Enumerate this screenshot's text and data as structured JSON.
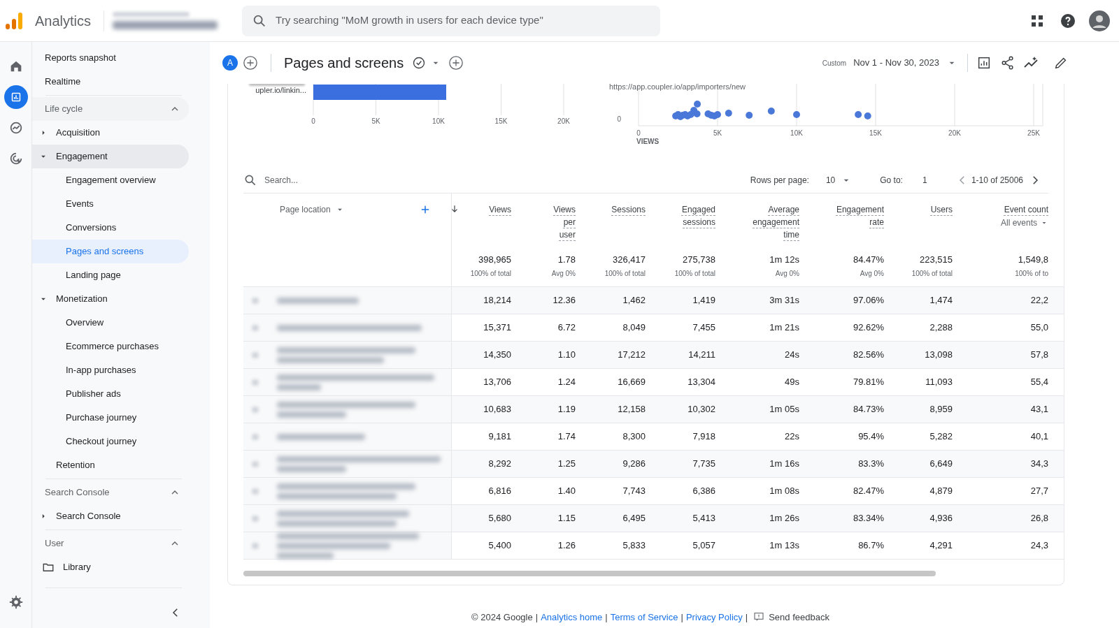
{
  "app": {
    "name": "Analytics"
  },
  "search": {
    "placeholder": "Try searching \"MoM growth in users for each device type\""
  },
  "rail": [
    {
      "kind": "home",
      "selected": false
    },
    {
      "kind": "reports",
      "selected": true
    },
    {
      "kind": "explore",
      "selected": false
    },
    {
      "kind": "advertising",
      "selected": false
    }
  ],
  "sidebar": {
    "top": [
      {
        "label": "Reports snapshot"
      },
      {
        "label": "Realtime"
      }
    ],
    "sections": [
      {
        "title": "Life cycle",
        "expanded": true,
        "items": [
          {
            "kind": "group",
            "label": "Acquisition",
            "expanded": false
          },
          {
            "kind": "group",
            "label": "Engagement",
            "expanded": true,
            "children": [
              {
                "label": "Engagement overview",
                "selected": false
              },
              {
                "label": "Events",
                "selected": false
              },
              {
                "label": "Conversions",
                "selected": false
              },
              {
                "label": "Pages and screens",
                "selected": true
              },
              {
                "label": "Landing page",
                "selected": false
              }
            ]
          },
          {
            "kind": "group",
            "label": "Monetization",
            "expanded": true,
            "children": [
              {
                "label": "Overview",
                "selected": false
              },
              {
                "label": "Ecommerce purchases",
                "selected": false
              },
              {
                "label": "In-app purchases",
                "selected": false
              },
              {
                "label": "Publisher ads",
                "selected": false
              },
              {
                "label": "Purchase journey",
                "selected": false
              },
              {
                "label": "Checkout journey",
                "selected": false
              }
            ]
          },
          {
            "kind": "link",
            "label": "Retention"
          }
        ]
      },
      {
        "title": "Search Console",
        "expanded": true,
        "items": [
          {
            "kind": "group",
            "label": "Search Console",
            "expanded": false
          }
        ]
      },
      {
        "title": "User",
        "expanded": true,
        "items": [
          {
            "kind": "folder",
            "label": "Library"
          }
        ]
      }
    ]
  },
  "report": {
    "avatar": "A",
    "title": "Pages and screens",
    "date_label": "Custom",
    "date_range": "Nov 1 - Nov 30, 2023"
  },
  "charts": [
    {
      "kind": "bar",
      "bar_label": "upler.io/linkin...",
      "x_tick_labels": [
        "0",
        "5K",
        "10K",
        "15K",
        "20K"
      ]
    },
    {
      "kind": "scatter",
      "axis_title": "VIEWS",
      "x_tick_labels": [
        "0",
        "5K",
        "10K",
        "15K",
        "20K",
        "25K"
      ],
      "note": "https://app.coupler.io/app/importers/new",
      "y_axis_label": "0"
    }
  ],
  "table": {
    "search_placeholder": "Search...",
    "rows_per_page_label": "Rows per page:",
    "rows_per_page": "10",
    "goto_label": "Go to:",
    "goto": "1",
    "range": "1-10 of 25006",
    "dimension": "Page location",
    "columns": [
      {
        "label": "Views",
        "sorted": true,
        "total": "398,965",
        "total_note": "100% of total"
      },
      {
        "label": "Views per user",
        "sorted": false,
        "total": "1.78",
        "total_note": "Avg 0%"
      },
      {
        "label": "Sessions",
        "sorted": false,
        "total": "326,417",
        "total_note": "100% of total"
      },
      {
        "label": "Engaged sessions",
        "sorted": false,
        "total": "275,738",
        "total_note": "100% of total"
      },
      {
        "label": "Average engagement time",
        "sorted": false,
        "total": "1m 12s",
        "total_note": "Avg 0%"
      },
      {
        "label": "Engagement rate",
        "sorted": false,
        "total": "84.47%",
        "total_note": "Avg 0%"
      },
      {
        "label": "Users",
        "sorted": false,
        "total": "223,515",
        "total_note": "100% of total"
      },
      {
        "label": "Event count",
        "sub": "All events",
        "sorted": false,
        "total": "1,549,8",
        "total_note": "100% of to"
      }
    ],
    "rows": [
      [
        "18,214",
        "12.36",
        "1,462",
        "1,419",
        "3m 31s",
        "97.06%",
        "1,474",
        "22,2"
      ],
      [
        "15,371",
        "6.72",
        "8,049",
        "7,455",
        "1m 21s",
        "92.62%",
        "2,288",
        "55,0"
      ],
      [
        "14,350",
        "1.10",
        "17,212",
        "14,211",
        "24s",
        "82.56%",
        "13,098",
        "57,8"
      ],
      [
        "13,706",
        "1.24",
        "16,669",
        "13,304",
        "49s",
        "79.81%",
        "11,093",
        "55,4"
      ],
      [
        "10,683",
        "1.19",
        "12,158",
        "10,302",
        "1m 05s",
        "84.73%",
        "8,959",
        "43,1"
      ],
      [
        "9,181",
        "1.74",
        "8,300",
        "7,918",
        "22s",
        "95.4%",
        "5,282",
        "40,1"
      ],
      [
        "8,292",
        "1.25",
        "9,286",
        "7,735",
        "1m 16s",
        "83.3%",
        "6,649",
        "34,3"
      ],
      [
        "6,816",
        "1.40",
        "7,743",
        "6,386",
        "1m 08s",
        "82.47%",
        "4,879",
        "27,7"
      ],
      [
        "5,680",
        "1.15",
        "6,495",
        "5,413",
        "1m 26s",
        "83.34%",
        "4,936",
        "26,8"
      ],
      [
        "5,400",
        "1.26",
        "5,833",
        "5,057",
        "1m 13s",
        "86.7%",
        "4,291",
        "24,3"
      ]
    ]
  },
  "footer": {
    "copyright": "© 2024 Google",
    "separator": "|",
    "links": [
      "Analytics home",
      "Terms of Service",
      "Privacy Policy"
    ],
    "feedback": "Send feedback"
  }
}
